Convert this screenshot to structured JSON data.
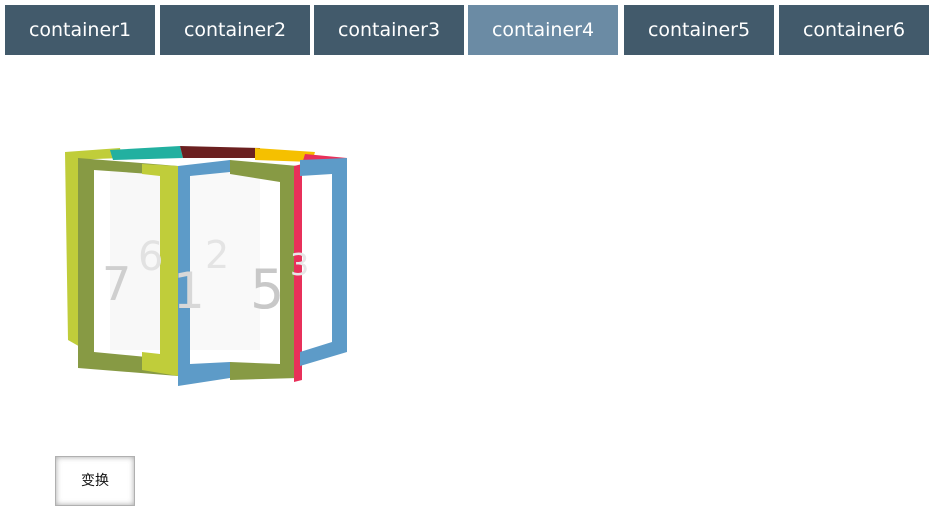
{
  "tabs": [
    {
      "label": "container1",
      "active": false
    },
    {
      "label": "container2",
      "active": false
    },
    {
      "label": "container3",
      "active": false
    },
    {
      "label": "container4",
      "active": true
    },
    {
      "label": "container5",
      "active": false
    },
    {
      "label": "container6",
      "active": false
    }
  ],
  "colors": {
    "tab_bg": "#425a6b",
    "tab_active_bg": "#6b8ba4",
    "frame_olive": "#879a44",
    "frame_lime": "#c0cd3a",
    "frame_blue": "#5d9bc8",
    "frame_teal": "#22b0a0",
    "frame_maroon": "#6b2020",
    "frame_yellow": "#f5c000",
    "frame_pink": "#e8305a"
  },
  "carousel": {
    "panel_numbers": [
      "7",
      "6",
      "2",
      "5",
      "1",
      "3"
    ]
  },
  "transform_button": {
    "label": "变换"
  }
}
